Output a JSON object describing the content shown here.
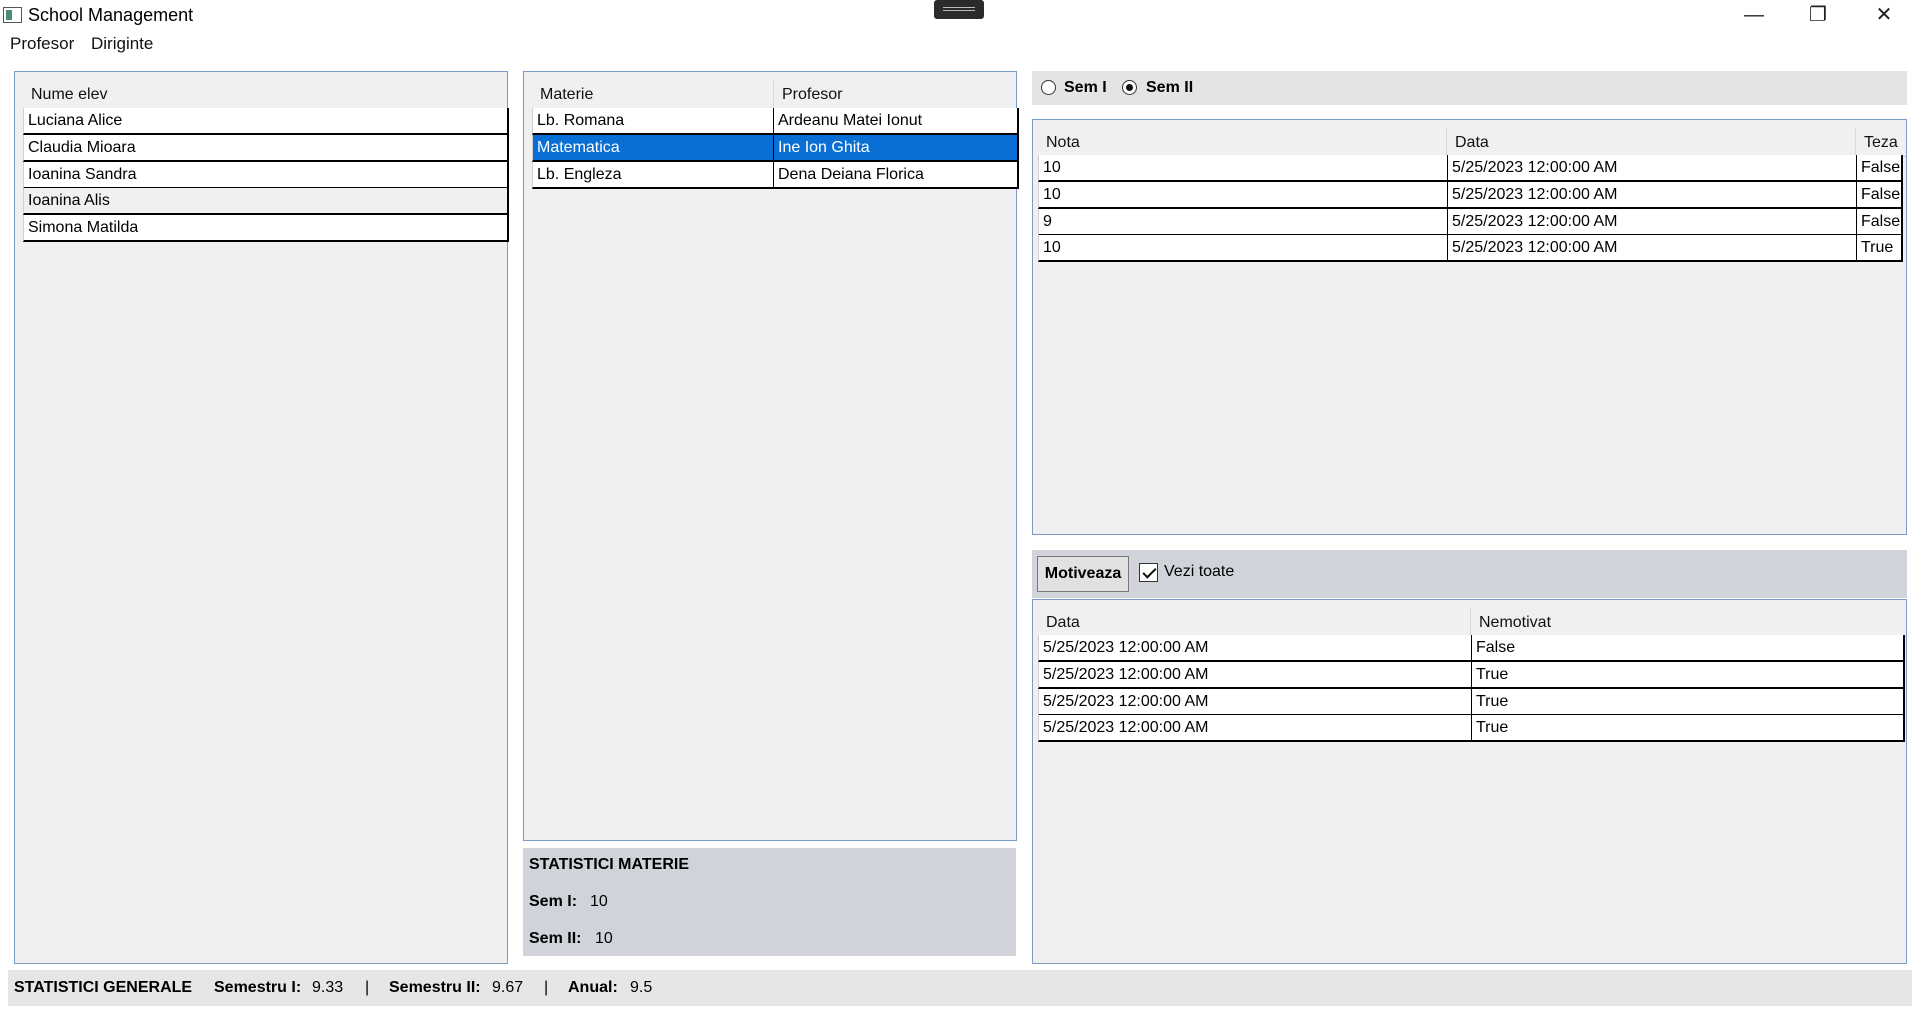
{
  "window": {
    "title": "School Management",
    "minimize_glyph": "—",
    "restore_glyph": "❐",
    "close_glyph": "✕"
  },
  "menu": {
    "items": [
      "Profesor",
      "Diriginte"
    ]
  },
  "students": {
    "header": "Nume elev",
    "rows": [
      "Luciana Alice",
      "Claudia Mioara",
      "Ioanina Sandra",
      "Ioanina Alis",
      "Simona Matilda"
    ]
  },
  "subjects": {
    "headers": [
      "Materie",
      "Profesor"
    ],
    "rows": [
      {
        "materie": "Lb. Romana",
        "profesor": "Ardeanu Matei Ionut"
      },
      {
        "materie": "Matematica",
        "profesor": "Ine Ion Ghita"
      },
      {
        "materie": "Lb. Engleza",
        "profesor": "Dena Deiana Florica"
      }
    ],
    "selected_index": 1
  },
  "stats_materie": {
    "title": "STATISTICI MATERIE",
    "sem1_label": "Sem I:",
    "sem1_value": "10",
    "sem2_label": "Sem II:",
    "sem2_value": "10"
  },
  "semester": {
    "option1": "Sem I",
    "option2": "Sem II",
    "selected": "Sem II"
  },
  "grades": {
    "headers": [
      "Nota",
      "Data",
      "Teza"
    ],
    "rows": [
      {
        "nota": "10",
        "data": "5/25/2023 12:00:00 AM",
        "teza": "False"
      },
      {
        "nota": "10",
        "data": "5/25/2023 12:00:00 AM",
        "teza": "False"
      },
      {
        "nota": "9",
        "data": "5/25/2023 12:00:00 AM",
        "teza": "False"
      },
      {
        "nota": "10",
        "data": "5/25/2023 12:00:00 AM",
        "teza": "True"
      }
    ]
  },
  "absences": {
    "motiveaza_label": "Motiveaza",
    "vezi_toate_label": "Vezi toate",
    "vezi_toate_checked": true,
    "headers": [
      "Data",
      "Nemotivat"
    ],
    "rows": [
      {
        "data": "5/25/2023 12:00:00 AM",
        "nemotivat": "False"
      },
      {
        "data": "5/25/2023 12:00:00 AM",
        "nemotivat": "True"
      },
      {
        "data": "5/25/2023 12:00:00 AM",
        "nemotivat": "True"
      },
      {
        "data": "5/25/2023 12:00:00 AM",
        "nemotivat": "True"
      }
    ]
  },
  "stats_generale": {
    "title": "STATISTICI GENERALE",
    "sem1_label": "Semestru I:",
    "sem1_value": "9.33",
    "sep": "|",
    "sem2_label": "Semestru II:",
    "sem2_value": "9.67",
    "anual_label": "Anual:",
    "anual_value": "9.5"
  },
  "colors": {
    "selection": "#0a6fd4",
    "panel_border": "#7a9cc6",
    "stats_bg": "#d0d4da"
  }
}
